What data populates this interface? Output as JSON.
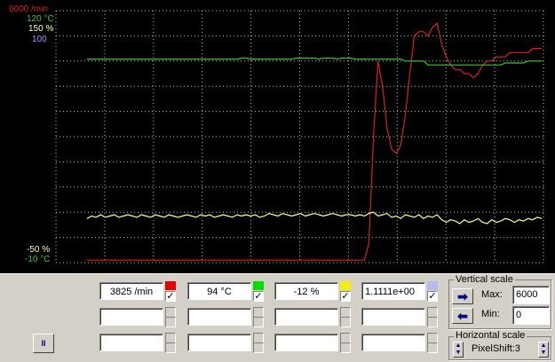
{
  "plot": {
    "y_axis_top": {
      "rpm": "6000 /min",
      "temp": "120 °C",
      "pct": "150 %",
      "val": "100"
    },
    "y_axis_bottom": {
      "pct": "-50 %",
      "temp": "-10 °C"
    },
    "colors": {
      "red": "#d62020",
      "green": "#40c040",
      "yellow": "#ffff99",
      "blue": "#8080ff",
      "grid": "#c0c0c0"
    }
  },
  "chart_data": {
    "type": "line",
    "title": "",
    "grid": true,
    "x": [
      0,
      1,
      2,
      3,
      4,
      5,
      6,
      7,
      8,
      9,
      10,
      11,
      12,
      13,
      14,
      15,
      16,
      17,
      18,
      19,
      20,
      21,
      22,
      23,
      24,
      25,
      26,
      27,
      28,
      29,
      30,
      31,
      32,
      33,
      34,
      35,
      36,
      37,
      38,
      39,
      40,
      41,
      42,
      43,
      44,
      45,
      46,
      47,
      48,
      49,
      50,
      51,
      52,
      53,
      54,
      55,
      56,
      57,
      58,
      59,
      60,
      61,
      62,
      63,
      64,
      65,
      66,
      67,
      68,
      69,
      70,
      71,
      72,
      73,
      74,
      75,
      76,
      77,
      78,
      79,
      80,
      81,
      82,
      83,
      84,
      85,
      86,
      87,
      88,
      89,
      90,
      91,
      92,
      93,
      94,
      95,
      96,
      97,
      98,
      99,
      100
    ],
    "series": [
      {
        "name": "rpm",
        "color": "#d62020",
        "ylim": [
          0,
          6000
        ],
        "values": [
          60,
          62,
          58,
          60,
          61,
          59,
          62,
          60,
          58,
          61,
          60,
          62,
          59,
          60,
          61,
          58,
          60,
          62,
          60,
          59,
          61,
          60,
          62,
          58,
          60,
          61,
          59,
          60,
          62,
          60,
          58,
          61,
          60,
          62,
          59,
          60,
          61,
          58,
          60,
          62,
          60,
          59,
          61,
          60,
          62,
          58,
          60,
          61,
          59,
          60,
          62,
          60,
          58,
          61,
          60,
          62,
          59,
          60,
          61,
          58,
          60,
          62,
          450,
          3000,
          4800,
          4200,
          3200,
          2700,
          2600,
          2800,
          3500,
          4500,
          5400,
          5500,
          5500,
          5400,
          5600,
          5700,
          5200,
          4900,
          4700,
          4600,
          4600,
          4500,
          4500,
          4400,
          4500,
          4700,
          4800,
          4800,
          4900,
          4900,
          4900,
          5000,
          5000,
          5000,
          5000,
          5000,
          5100,
          5100,
          5100
        ]
      },
      {
        "name": "temp",
        "color": "#40c040",
        "ylim": [
          -10,
          120
        ],
        "values": [
          95,
          95,
          95,
          95,
          95,
          95,
          95,
          95,
          95,
          95,
          95,
          95,
          95,
          95,
          95,
          95,
          95,
          95,
          95,
          95,
          95,
          95,
          95,
          95,
          95,
          95,
          95,
          95,
          95,
          95,
          95,
          95,
          95,
          95,
          95.5,
          95.5,
          95,
          95,
          95,
          95,
          95,
          95,
          95,
          95,
          95,
          95,
          95.5,
          95.5,
          95.5,
          95.5,
          95.5,
          95,
          95.5,
          95.5,
          95.5,
          95,
          95.5,
          95.5,
          95.5,
          95,
          95,
          95,
          95,
          95,
          95,
          95,
          95,
          95,
          95,
          95,
          94,
          94,
          94,
          94,
          94,
          92,
          92,
          92,
          92,
          92,
          92,
          92,
          92,
          92,
          92,
          92,
          92,
          92,
          92,
          92,
          92,
          92,
          93,
          93,
          93,
          93,
          93,
          94,
          94,
          94,
          94
        ]
      },
      {
        "name": "pct",
        "color": "#ffff99",
        "ylim": [
          -50,
          150
        ],
        "values": [
          -15,
          -13,
          -14,
          -12,
          -14,
          -13,
          -12,
          -14,
          -13,
          -12,
          -13,
          -14,
          -12,
          -13,
          -14,
          -12,
          -13,
          -14,
          -12,
          -13,
          -14,
          -13,
          -12,
          -13,
          -14,
          -12,
          -13,
          -12,
          -14,
          -13,
          -12,
          -13,
          -14,
          -12,
          -13,
          -12,
          -13,
          -12,
          -14,
          -13,
          -11,
          -12,
          -13,
          -11,
          -12,
          -13,
          -12,
          -11,
          -13,
          -12,
          -11,
          -12,
          -13,
          -12,
          -11,
          -12,
          -13,
          -12,
          -12,
          -13,
          -12,
          -13,
          -11,
          -10,
          -13,
          -12,
          -11,
          -14,
          -13,
          -15,
          -12,
          -13,
          -14,
          -12,
          -15,
          -13,
          -14,
          -12,
          -16,
          -18,
          -16,
          -17,
          -19,
          -16,
          -18,
          -17,
          -15,
          -18,
          -19,
          -16,
          -18,
          -17,
          -15,
          -16,
          -18,
          -16,
          -17,
          -15,
          -16,
          -14,
          -15
        ]
      },
      {
        "name": "val",
        "color": "#8080ff",
        "ylim": [
          0,
          100
        ],
        "values": []
      }
    ]
  },
  "panel": {
    "channels": [
      {
        "value": "3825 /min",
        "swatch": "#e00000",
        "checked": true
      },
      {
        "value": "94 °C",
        "swatch": "#00e000",
        "checked": true
      },
      {
        "value": "-12 %",
        "swatch": "#f0f000",
        "checked": true
      },
      {
        "value": "1.1111e+00",
        "swatch": "#b8b8f0",
        "checked": true
      }
    ],
    "check_mark": "✓",
    "pause_label": "II",
    "vertical_scale": {
      "title": "Vertical scale",
      "max_label": "Max:",
      "max_value": "6000",
      "min_label": "Min:",
      "min_value": "0",
      "right_arrow": "➡",
      "left_arrow": "⬅"
    },
    "horizontal_scale": {
      "title": "Horizontal scale",
      "value": "PixelShift:3"
    }
  }
}
